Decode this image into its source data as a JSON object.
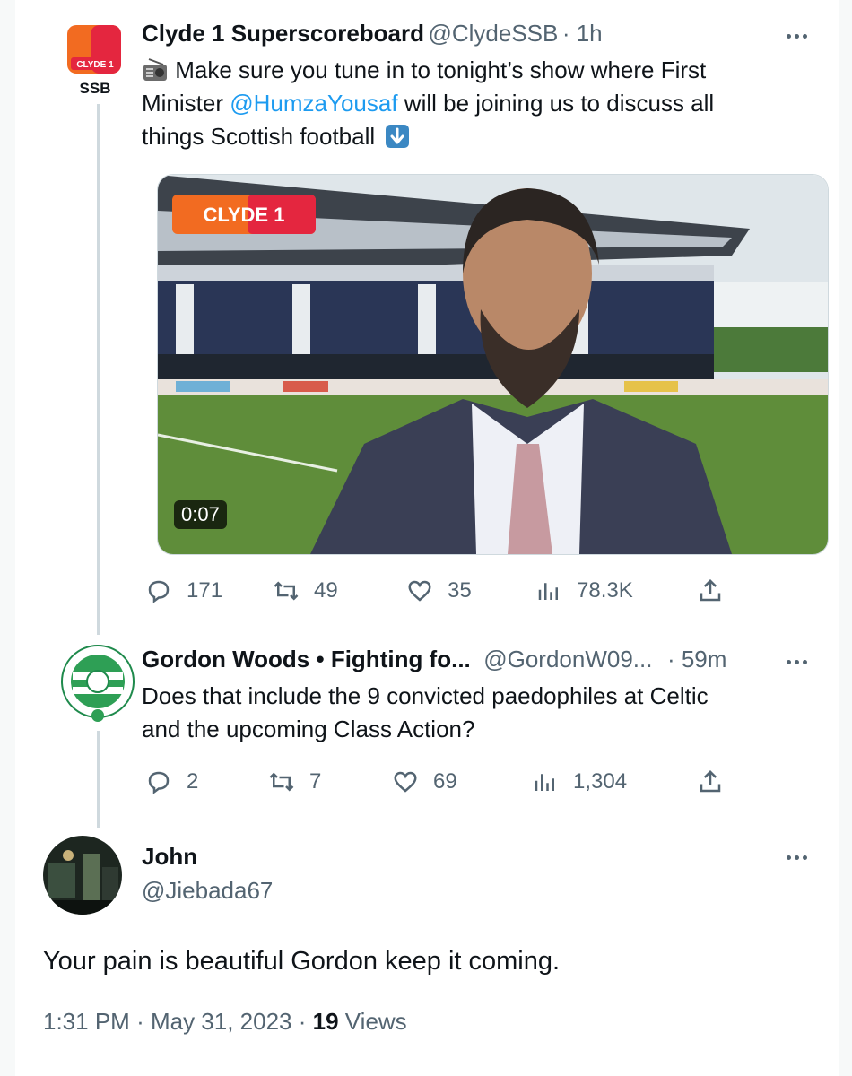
{
  "tweet1": {
    "name": "Clyde 1 Superscoreboard",
    "handle": "@ClydeSSB",
    "time": "· 1h",
    "logo_text": "CLYDE 1",
    "logo_sub": "SSB",
    "line1": "Make sure you tune in to tonight’s show where First",
    "line2_pre": "Minister ",
    "mention": "@HumzaYousaf",
    "line2_post": " will be joining us to discuss all",
    "line3": "things Scottish football",
    "video_duration": "0:07",
    "video_brand": "CLYDE 1",
    "stats": {
      "replies": "171",
      "retweets": "49",
      "likes": "35",
      "views": "78.3K"
    }
  },
  "tweet2": {
    "name": "Gordon Woods • Fighting fo...",
    "handle": "@GordonW09...",
    "time": "· 59m",
    "line1": "Does that include the 9 convicted paedophiles at Celtic",
    "line2": "and the upcoming Class Action?",
    "stats": {
      "replies": "2",
      "retweets": "7",
      "likes": "69",
      "views": "1,304"
    }
  },
  "tweet3": {
    "name": "John",
    "handle": "@Jiebada67",
    "text": "Your pain is beautiful Gordon keep it coming.",
    "time": "1:31 PM",
    "date": "May 31, 2023",
    "views_count": "19",
    "views_label": "Views"
  },
  "colors": {
    "accent": "#1d9bf0",
    "muted": "#536471",
    "brand_orange": "#f26b21",
    "brand_red": "#e4263f"
  }
}
